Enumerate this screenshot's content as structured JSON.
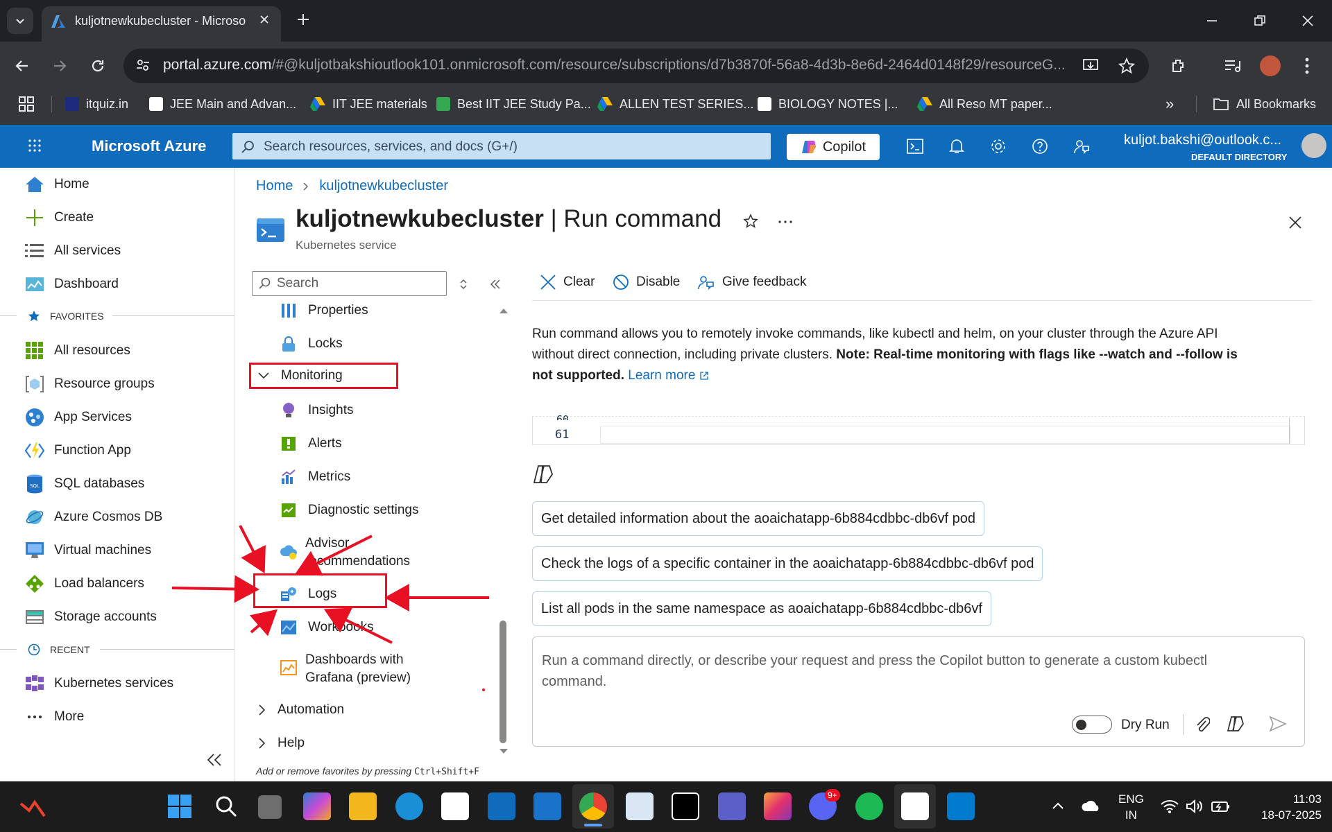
{
  "browser": {
    "tab_title": "kuljotnewkubecluster - Microso",
    "url_host": "portal.azure.com",
    "url_rest": "/#@kuljotbakshioutlook101.onmicrosoft.com/resource/subscriptions/d7b3870f-56a8-4d3b-8e6d-2464d0148f29/resourceG...",
    "bookmarks": [
      "itquiz.in",
      "JEE Main and Advan...",
      "IIT JEE materials",
      "Best IIT JEE Study Pa...",
      "ALLEN TEST SERIES...",
      "BIOLOGY NOTES |...",
      "All Reso MT paper..."
    ],
    "bookmarks_overflow": "»",
    "all_bookmarks": "All Bookmarks"
  },
  "azure": {
    "brand": "Microsoft Azure",
    "search_placeholder": "Search resources, services, and docs (G+/)",
    "copilot_label": "Copilot",
    "account_name": "kuljot.bakshi@outlook.c...",
    "account_directory": "DEFAULT DIRECTORY",
    "accent_color": "#0f6cbd"
  },
  "leftnav": {
    "items_top": [
      {
        "label": "Home",
        "icon": "home-icon"
      },
      {
        "label": "Create",
        "icon": "plus-icon"
      },
      {
        "label": "All services",
        "icon": "list-icon"
      },
      {
        "label": "Dashboard",
        "icon": "dashboard-icon"
      }
    ],
    "favorites_title": "FAVORITES",
    "favorites": [
      {
        "label": "All resources",
        "icon": "grid-icon"
      },
      {
        "label": "Resource groups",
        "icon": "resource-group-icon"
      },
      {
        "label": "App Services",
        "icon": "app-services-icon"
      },
      {
        "label": "Function App",
        "icon": "function-icon"
      },
      {
        "label": "SQL databases",
        "icon": "sql-icon"
      },
      {
        "label": "Azure Cosmos DB",
        "icon": "cosmos-icon"
      },
      {
        "label": "Virtual machines",
        "icon": "vm-icon"
      },
      {
        "label": "Load balancers",
        "icon": "load-balancer-icon"
      },
      {
        "label": "Storage accounts",
        "icon": "storage-icon"
      }
    ],
    "recent_title": "RECENT",
    "recent": [
      {
        "label": "Kubernetes services",
        "icon": "kubernetes-icon"
      }
    ],
    "more": "More"
  },
  "breadcrumb": [
    "Home",
    "kuljotnewkubecluster"
  ],
  "page": {
    "resource_name": "kuljotnewkubecluster",
    "blade_title": "| Run command",
    "subtitle": "Kubernetes service"
  },
  "resource_menu": {
    "search_placeholder": "Search",
    "items_before": [
      "Properties",
      "Locks"
    ],
    "monitoring_group": "Monitoring",
    "monitoring_items": [
      "Insights",
      "Alerts",
      "Metrics",
      "Diagnostic settings",
      "Advisor recommendations",
      "Logs",
      "Workbooks",
      "Dashboards with Grafana (preview)"
    ],
    "collapsed_groups": [
      "Automation",
      "Help"
    ]
  },
  "commands": {
    "clear": "Clear",
    "disable": "Disable",
    "feedback": "Give feedback"
  },
  "description": {
    "text": "Run command allows you to remotely invoke commands, like kubectl and helm, on your cluster through the Azure API without direct connection, including private clusters.",
    "note": "Note: Real-time monitoring with flags like --watch and --follow is not supported.",
    "learn_more": "Learn more"
  },
  "editor": {
    "prev_line_number": "60",
    "line_number": "61"
  },
  "suggestions": [
    "Get detailed information about the aoaichatapp-6b884cdbbc-db6vf pod",
    "Check the logs of a specific container in the aoaichatapp-6b884cdbbc-db6vf pod",
    "List all pods in the same namespace as aoaichatapp-6b884cdbbc-db6vf"
  ],
  "prompt": {
    "placeholder": "Run a command directly, or describe your request and press the Copilot button to generate a custom kubectl command.",
    "dry_run_label": "Dry Run",
    "dry_run_enabled": false
  },
  "footer_hint": {
    "text": "Add or remove favorites by pressing",
    "shortcut": "Ctrl+Shift+F"
  },
  "taskbar": {
    "lang_line1": "ENG",
    "lang_line2": "IN",
    "time": "11:03",
    "date": "18-07-2025",
    "discord_badge": "9+"
  }
}
